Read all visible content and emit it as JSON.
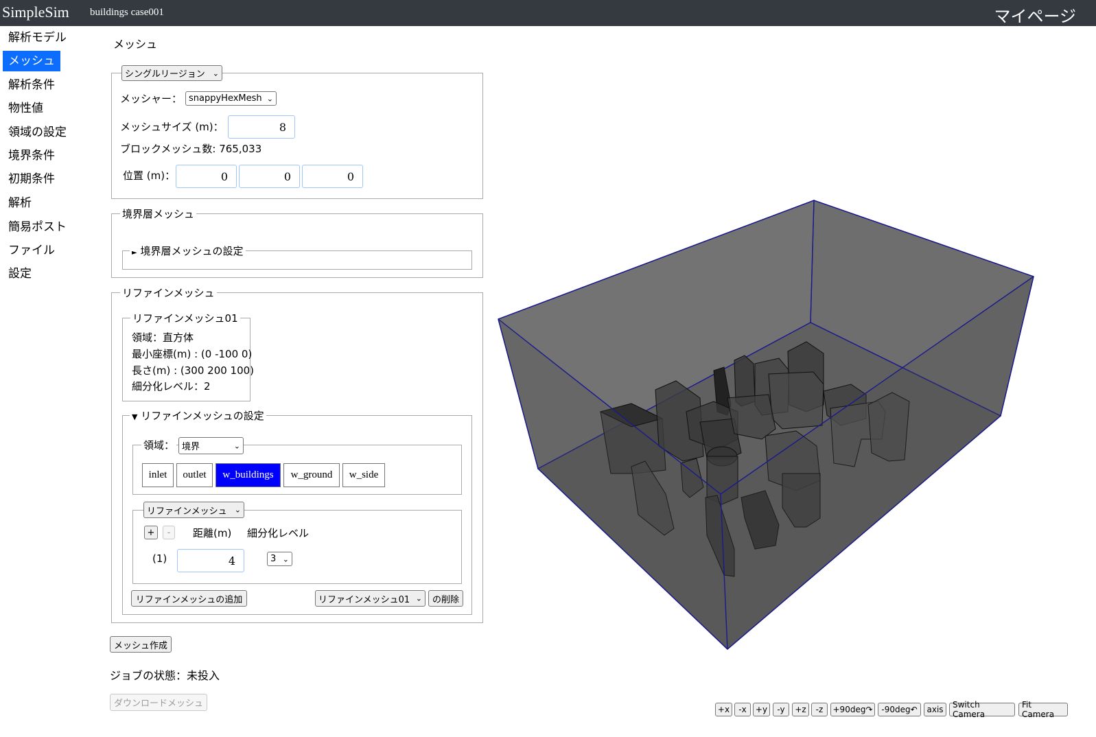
{
  "header": {
    "brand": "SimpleSim",
    "project": "buildings case001",
    "mypage": "マイページ"
  },
  "sidebar": {
    "items": [
      {
        "label": "解析モデル"
      },
      {
        "label": "メッシュ",
        "active": true
      },
      {
        "label": "解析条件"
      },
      {
        "label": "物性値"
      },
      {
        "label": "領域の設定"
      },
      {
        "label": "境界条件"
      },
      {
        "label": "初期条件"
      },
      {
        "label": "解析"
      },
      {
        "label": "簡易ポスト"
      },
      {
        "label": "ファイル"
      },
      {
        "label": "設定"
      }
    ]
  },
  "main": {
    "title": "メッシュ",
    "region_select": "シングルリージョン",
    "mesher_label": "メッシャー：",
    "mesher_value": "snappyHexMesh",
    "mesh_size_label": "メッシュサイズ (m)：",
    "mesh_size_value": "8",
    "block_mesh_label": "ブロックメッシュ数: 765,033",
    "position_label": "位置 (m)：",
    "position": [
      "0",
      "0",
      "0"
    ],
    "boundary_layer": {
      "legend": "境界層メッシュ",
      "settings_legend": "境界層メッシュの設定"
    },
    "refine": {
      "legend": "リファインメッシュ",
      "item_legend": "リファインメッシュ01",
      "lines": [
        "領域：直方体",
        "最小座標(m) : (0 -100 0)",
        "長さ(m) : (300 200 100)",
        "細分化レベル：2"
      ],
      "settings_legend": "リファインメッシュの設定",
      "region_label": "領域：",
      "region_value": "境界",
      "patches": [
        "inlet",
        "outlet",
        "w_buildings",
        "w_ground",
        "w_side"
      ],
      "active_patch": "w_buildings",
      "mode_select": "リファインメッシュ",
      "plus": "+",
      "minus": "-",
      "distance_header": "距離(m)",
      "level_header": "細分化レベル",
      "row_index": "(1)",
      "row_distance": "4",
      "row_level": "3",
      "add_button": "リファインメッシュの追加",
      "target_select": "リファインメッシュ01",
      "delete_button": "の削除"
    },
    "create_button": "メッシュ作成",
    "job_status": "ジョブの状態：未投入",
    "download_button": "ダウンロードメッシュ"
  },
  "viewer": {
    "buttons": [
      "+x",
      "-x",
      "+y",
      "-y",
      "+z",
      "-z",
      "+90deg↷",
      "-90deg↶",
      "axis",
      "Switch Camera",
      "Fit Camera"
    ],
    "edge_color": "#1a1a8c",
    "fill_color": "#4a4a4a"
  }
}
